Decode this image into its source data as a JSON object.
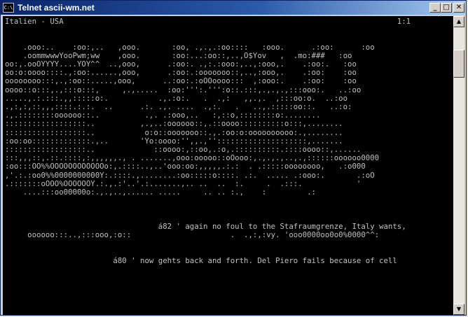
{
  "window": {
    "title": "Telnet ascii-wm.net",
    "icon_label": "C:\\",
    "buttons": {
      "minimize": "_",
      "maximize": "□",
      "close": "✕"
    }
  },
  "scrollbar": {
    "up": "▲",
    "down": "▼"
  },
  "console": {
    "text": "Italien - USA                                                                          1:1\n\n\n    .ooo:..    :oo:,..   ,ooo.       :oo, .,.,.:oo::::   :ooo.      .:oo:      :oo\n    .oommwwwYooPwm;ww    ,ooo.       :oo:...:oo::,..,O$Yov   ,  .mo:###   :oo\noo:,.ooOYYYY....YOY^^  ..,ooo,      .:oo:. .,:.:ooo:,..,:ooo,.    .:oo:.   :oo\noo:o:oooo::::.,:oo:......,ooo,      .:oo:.:ooooooo::,..,:ooo,.    .:oo:    :oo\noooooooo:::,.,:oo::.....,ooo,      ..:oo:.:oOOoooo:::  ,:ooo:.    .:oo:    :oo\noooo::o:::,.,:::o:::,     ,.,.....  :oo:''':.''':o::.:::,.,.,.,:::ooo:.   ..:oo\n.....,.:.:::.,,:::::o:.           .,.:o:.   .  .,:   ,,.,.  ,:::oo:o.  ..:oo\n.,:,:,::,,,::::.:.:.  ..      .:. .,. ....  .,:.   .   ..,.:::::oo::.   ..:o:\n.,.::::::::oooooo::..          .,. .:ooo,..   :,::o,::::::::o:........\n::::::::::::::::::..          ,.,..:oooooo::,.::oooo::::::::::o:::,........\n::::::::::::::::::..           o:o::ooooooo::.,.:oo:o:oooooooooo:.,........\n:oo:oo:::::::::::::.,..       'Yo:oooo:'',,.,''::::::::::::::::::::,.......\n::::::::::::::::::..             ::oooo:,::oo,.:o,.::::::::::.::::oooo::,......\n:::,,,::,.::.::::,:,,,,,,., . .......,ooo:ooooo::oOooo:,.,.,.,..,.,::::::oooooo0000\n:oo:::OO%%OOOOOOOOOOOOo:,.::::..,..'ooo:oo:,,,,,.:.:  . .:::::oooooooo,   .:o000\n,'.:.:oo0%%0000000000Y:.::::.,........:oo:::::o::::. .:.  ..... .:ooo:.       .:oO\n.:::::::oOOO%OOOOOOY.:.,.:'..'.:.......,.. ..  ..  :.     .  .:::.            '\n    ....:::oo00000o:.,.,..,...... .....     .. .. :.,    :         .:\n\n\n\n                                  á82 ' again no foul to the Stafraumgrenze, Italy wants,\n     oooooo:::..,:::ooo,:o::                      .  .,:,:vy. 'ooo0000oo0o0%0000^^:\n\n\n                        á80 ' now gehts back and forth. Del Piero fails because of cell"
  }
}
